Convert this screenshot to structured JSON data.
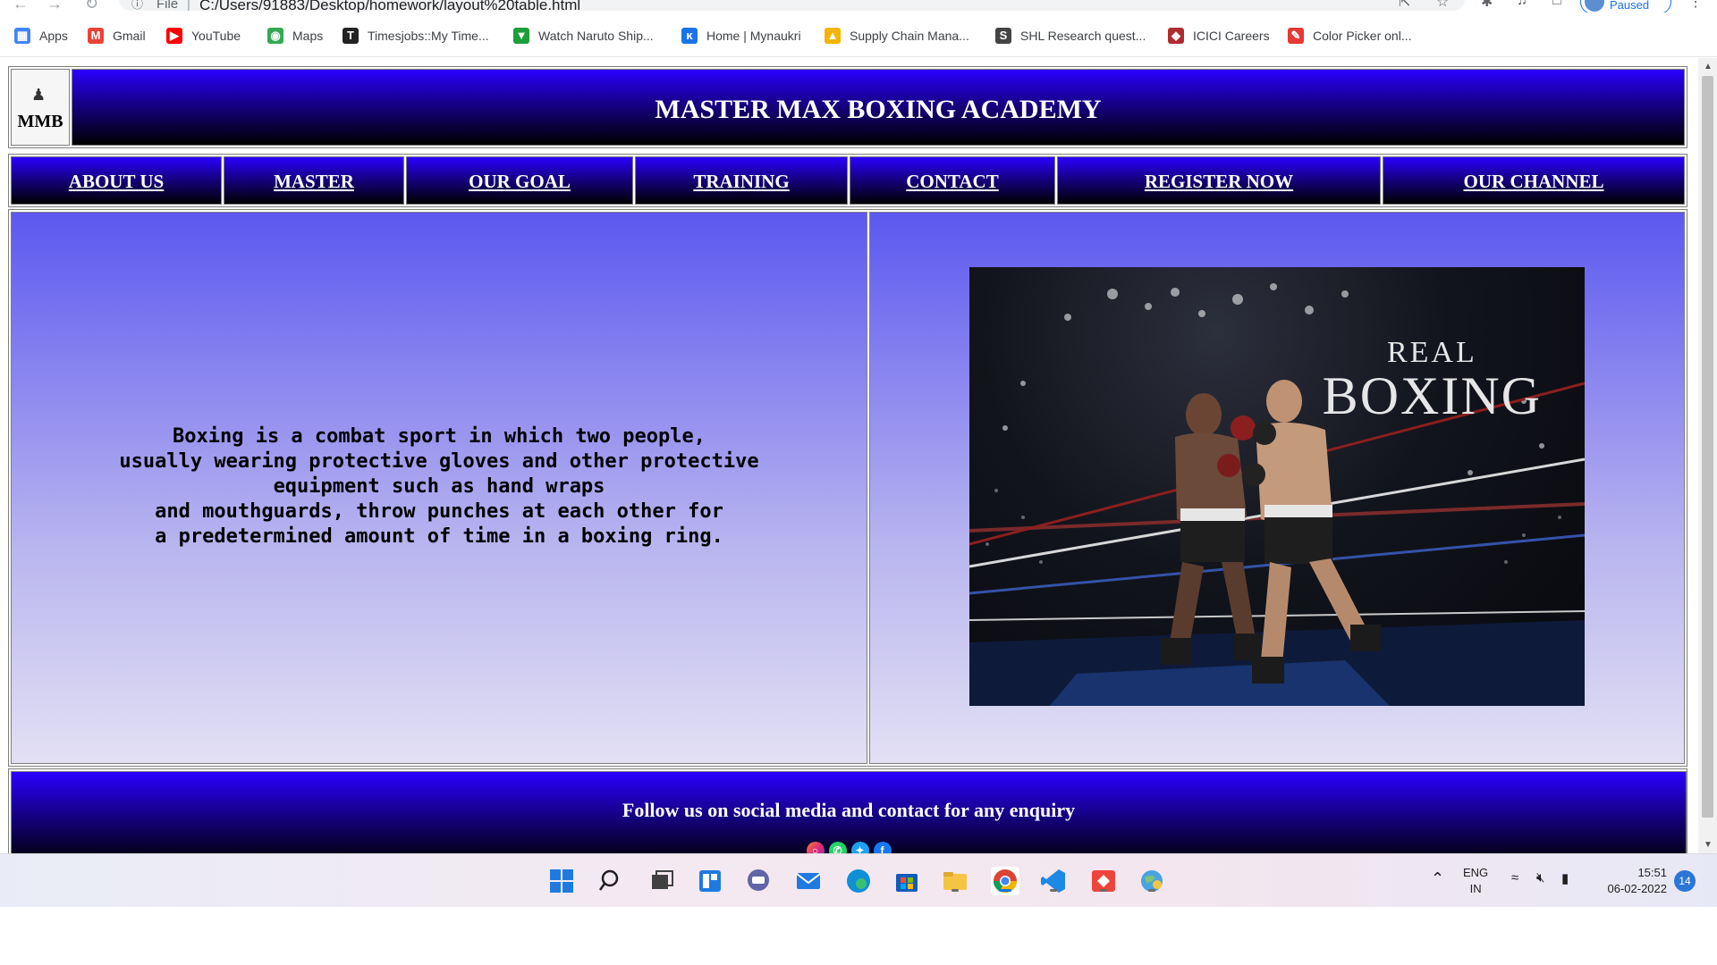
{
  "browser": {
    "address_scheme": "File",
    "address_url": "C:/Users/91883/Desktop/homework/layout%20table.html",
    "profile_status": "Paused",
    "bookmarks": [
      {
        "label": "Apps",
        "icon": "apps-grid-icon",
        "color": "#4285f4"
      },
      {
        "label": "Gmail",
        "icon": "gmail-icon",
        "color": "#ea4335"
      },
      {
        "label": "YouTube",
        "icon": "youtube-icon",
        "color": "#ff0000"
      },
      {
        "label": "Maps",
        "icon": "maps-pin-icon",
        "color": "#34a853"
      },
      {
        "label": "Timesjobs::My Time...",
        "icon": "timesjobs-icon",
        "color": "#222222"
      },
      {
        "label": "Watch Naruto Ship...",
        "icon": "shield-icon",
        "color": "#1e9e3a"
      },
      {
        "label": "Home | Mynaukri",
        "icon": "mynaukri-icon",
        "color": "#1a73e8"
      },
      {
        "label": "Supply Chain Mana...",
        "icon": "supply-chain-icon",
        "color": "#f4b400"
      },
      {
        "label": "SHL Research quest...",
        "icon": "shl-icon",
        "color": "#444444"
      },
      {
        "label": "ICICI Careers",
        "icon": "icici-icon",
        "color": "#b02a30"
      },
      {
        "label": "Color Picker onl...",
        "icon": "color-picker-icon",
        "color": "#e53935"
      }
    ]
  },
  "site": {
    "logo_text": "MMB",
    "title": "MASTER MAX BOXING ACADEMY",
    "nav": [
      "ABOUT US",
      "MASTER",
      "OUR GOAL",
      "TRAINING",
      "CONTACT",
      "REGISTER NOW",
      "OUR CHANNEL"
    ],
    "intro_text": "Boxing is a combat sport in which two people,\nusually wearing protective gloves and other protective\nequipment such as hand wraps\nand mouthguards, throw punches at each other for\na predetermined amount of time in a boxing ring.",
    "image_caption_top": "REAL",
    "image_caption_bottom": "BOXING",
    "footer_text": "Follow us on social media and contact for any enquiry",
    "social_icons": [
      "instagram-icon",
      "whatsapp-icon",
      "twitter-icon",
      "facebook-icon"
    ],
    "colors": {
      "header_top": "#2a00ff",
      "header_bottom": "#000000",
      "panel_top": "#5c58f0",
      "panel_bottom": "#e3e0f4"
    }
  },
  "taskbar": {
    "apps": [
      "start-icon",
      "search-icon",
      "task-view-icon",
      "widgets-icon",
      "teams-chat-icon",
      "mail-icon",
      "edge-icon",
      "store-icon",
      "file-explorer-icon",
      "chrome-icon",
      "vscode-icon",
      "anydesk-icon",
      "browser-globe-icon"
    ],
    "lang_top": "ENG",
    "lang_bottom": "IN",
    "time": "15:51",
    "date": "06-02-2022",
    "notifications": "14"
  }
}
